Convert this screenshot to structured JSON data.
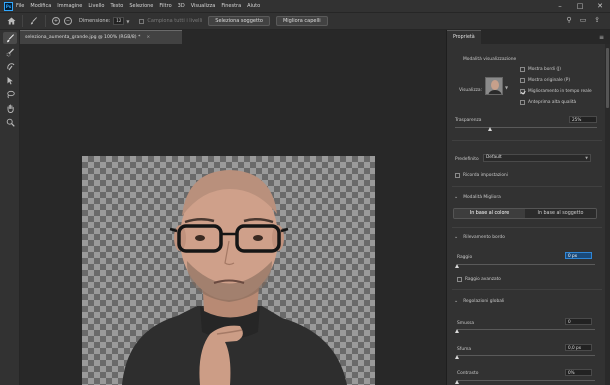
{
  "app_logo": "Ps",
  "menu": [
    "File",
    "Modifica",
    "Immagine",
    "Livello",
    "Testo",
    "Selezione",
    "Filtro",
    "3D",
    "Visualizza",
    "Finestra",
    "Aiuto"
  ],
  "window_controls": [
    "–",
    "□",
    "✕"
  ],
  "options_bar": {
    "size_label": "Dimensione:",
    "size_value": "12",
    "sample_all_label": "Campiona tutti i livelli",
    "select_subject_button": "Seleziona soggetto",
    "refine_hair_button": "Migliora capelli",
    "icons": [
      "home-icon",
      "brush-icon",
      "help-icon",
      "search-icon",
      "workspace-icon",
      "share-icon"
    ]
  },
  "document_tab": {
    "title": "seleziona_aumenta_grande.jpg @ 100% (RGB/8) *",
    "close": "×"
  },
  "tools": [
    "brush-icon",
    "quick-selection-icon",
    "refine-edge-icon",
    "object-select-icon",
    "lasso-icon",
    "hand-icon",
    "zoom-icon"
  ],
  "panel": {
    "tab": "Proprietà",
    "view_mode_title": "Modalità visualizzazione",
    "view_label": "Visualizza:",
    "show_edges": "Mostra bordi (J)",
    "show_original": "Mostra originale (P)",
    "realtime_refine": "Miglioramento in tempo reale",
    "high_quality": "Anteprima alta qualità",
    "transparency_label": "Trasparenza",
    "transparency_value": "25%",
    "transparency_fraction": 0.25,
    "preset_label": "Predefinito",
    "preset_value": "Default",
    "remember_settings": "Ricorda impostazioni",
    "refine_mode_title": "Modalità Migliora",
    "refine_mode_color": "In base al colore",
    "refine_mode_object": "In base al soggetto",
    "edge_detection_title": "Rilevamento bordo",
    "radius_label": "Raggio",
    "radius_value": "0 px",
    "smart_radius": "Raggio avanzato",
    "global_title": "Regolazioni globali",
    "smooth_label": "Smussa",
    "smooth_value": "0",
    "feather_label": "Sfuma",
    "feather_value": "0,0 px",
    "contrast_label": "Contrasto",
    "contrast_value": "0%"
  }
}
